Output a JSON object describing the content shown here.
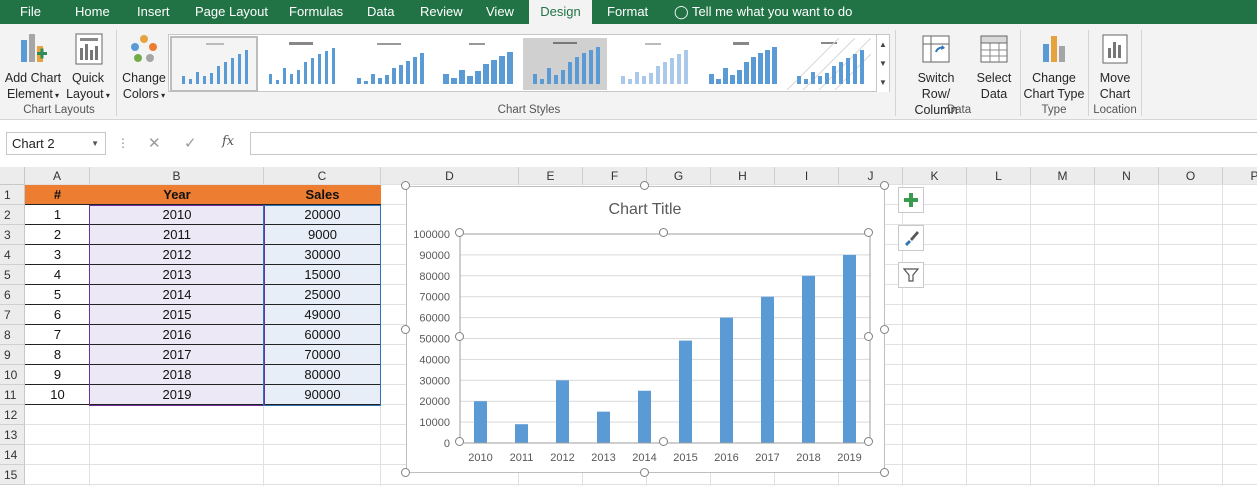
{
  "tabs": [
    "File",
    "Home",
    "Insert",
    "Page Layout",
    "Formulas",
    "Data",
    "Review",
    "View",
    "Design",
    "Format"
  ],
  "tell_me": "Tell me what you want to do",
  "ribbon": {
    "add_chart_element": [
      "Add Chart",
      "Element"
    ],
    "quick_layout": [
      "Quick",
      "Layout"
    ],
    "change_colors": [
      "Change",
      "Colors"
    ],
    "switch_row_column": [
      "Switch Row/",
      "Column"
    ],
    "select_data": [
      "Select",
      "Data"
    ],
    "change_chart_type": [
      "Change",
      "Chart Type"
    ],
    "move_chart": [
      "Move",
      "Chart"
    ],
    "group_chart_layouts": "Chart Layouts",
    "group_chart_styles": "Chart Styles",
    "group_data": "Data",
    "group_type": "Type",
    "group_location": "Location"
  },
  "formula_bar": {
    "name_box": "Chart 2",
    "fx": "fx",
    "value": ""
  },
  "columns": [
    "A",
    "B",
    "C",
    "D",
    "E",
    "F",
    "G",
    "H",
    "I",
    "J",
    "K",
    "L",
    "M",
    "N",
    "O",
    "P"
  ],
  "rows": [
    "1",
    "2",
    "3",
    "4",
    "5",
    "6",
    "7",
    "8",
    "9",
    "10",
    "11",
    "12",
    "13",
    "14",
    "15"
  ],
  "table": {
    "headers": [
      "#",
      "Year",
      "Sales"
    ],
    "rows": [
      [
        "1",
        "2010",
        "20000"
      ],
      [
        "2",
        "2011",
        "9000"
      ],
      [
        "3",
        "2012",
        "30000"
      ],
      [
        "4",
        "2013",
        "15000"
      ],
      [
        "5",
        "2014",
        "25000"
      ],
      [
        "6",
        "2015",
        "49000"
      ],
      [
        "7",
        "2016",
        "60000"
      ],
      [
        "8",
        "2017",
        "70000"
      ],
      [
        "9",
        "2018",
        "80000"
      ],
      [
        "10",
        "2019",
        "90000"
      ]
    ]
  },
  "chart_data": {
    "type": "bar",
    "title": "Chart Title",
    "categories": [
      "2010",
      "2011",
      "2012",
      "2013",
      "2014",
      "2015",
      "2016",
      "2017",
      "2018",
      "2019"
    ],
    "values": [
      20000,
      9000,
      30000,
      15000,
      25000,
      49000,
      60000,
      70000,
      80000,
      90000
    ],
    "ylim": [
      0,
      100000
    ],
    "yticks": [
      "0",
      "10000",
      "20000",
      "30000",
      "40000",
      "50000",
      "60000",
      "70000",
      "80000",
      "90000",
      "100000"
    ],
    "bar_color": "#5b9bd5",
    "grid": true,
    "legend": "none"
  },
  "colors": {
    "ribbon_green": "#217346",
    "header_orange": "#ed7d31",
    "bar_blue": "#5b9bd5"
  }
}
